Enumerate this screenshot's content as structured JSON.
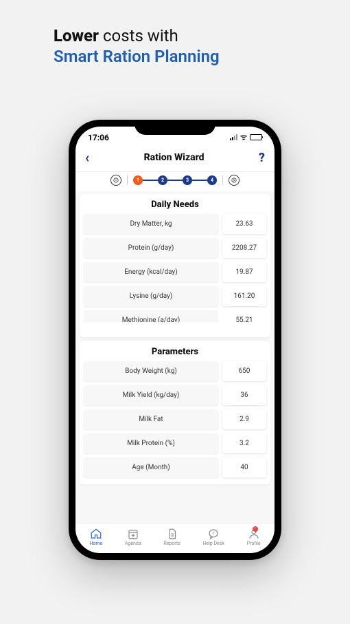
{
  "headline": {
    "line1_bold": "Lower",
    "line1_rest": " costs with",
    "line2": "Smart Ration Planning"
  },
  "status": {
    "time": "17:06"
  },
  "header": {
    "title": "Ration Wizard",
    "help": "?",
    "back": "‹"
  },
  "steps": {
    "items": [
      "1",
      "2",
      "3",
      "4"
    ],
    "active": 0,
    "prev": "⊖",
    "next": "⊕"
  },
  "daily_needs": {
    "title": "Daily Needs",
    "rows": [
      {
        "label": "Dry Matter, kg",
        "value": "23.63"
      },
      {
        "label": "Protein (g/day)",
        "value": "2208.27"
      },
      {
        "label": "Energy (kcal/day)",
        "value": "19.87"
      },
      {
        "label": "Lysine (g/day)",
        "value": "161.20"
      },
      {
        "label": "Methionine (a/dav)",
        "value": "55.21"
      }
    ]
  },
  "parameters": {
    "title": "Parameters",
    "rows": [
      {
        "label": "Body Weight (kg)",
        "value": "650"
      },
      {
        "label": "Milk Yield (kg/day)",
        "value": "36"
      },
      {
        "label": "Milk Fat",
        "value": "2.9"
      },
      {
        "label": "Milk Protein (%)",
        "value": "3.2"
      },
      {
        "label": "Age (Month)",
        "value": "40"
      }
    ]
  },
  "nav": {
    "items": [
      {
        "label": "Home"
      },
      {
        "label": "Agenda"
      },
      {
        "label": "Reports"
      },
      {
        "label": "Help Desk"
      },
      {
        "label": "Profile"
      }
    ],
    "badge": "!"
  }
}
